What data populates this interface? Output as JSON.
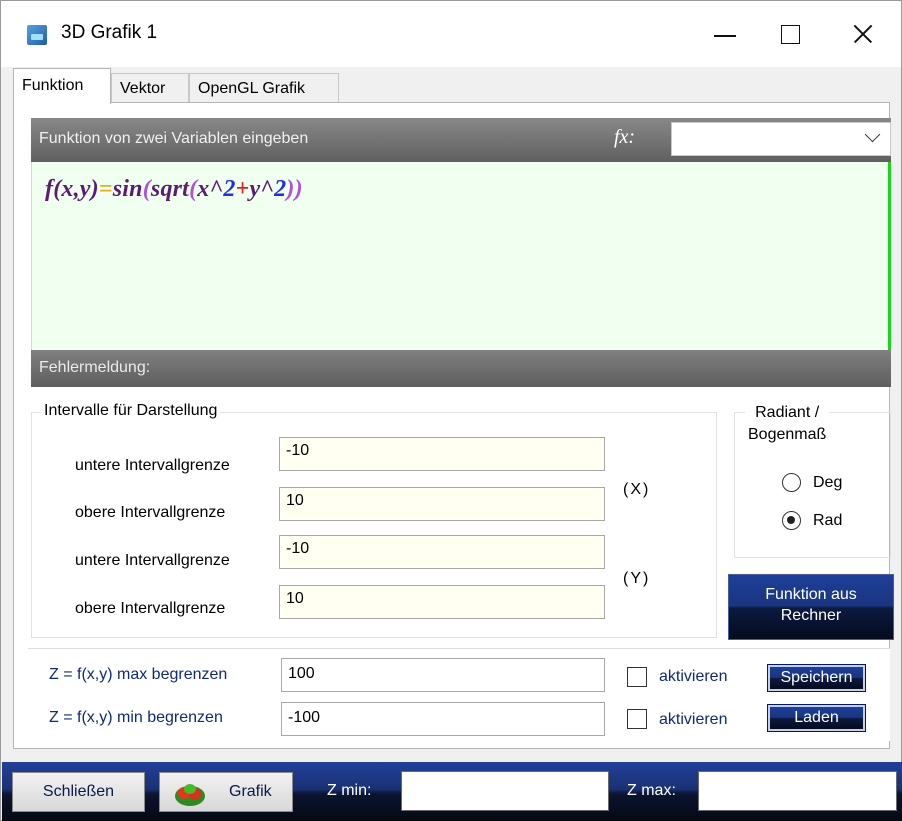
{
  "window": {
    "title": "3D Grafik 1",
    "icon": "app-3d-icon",
    "controls": [
      "minimize-icon",
      "maximize-icon",
      "close-icon"
    ]
  },
  "tabs": [
    {
      "label": "Funktion",
      "active": true
    },
    {
      "label": "Vektor",
      "active": false
    },
    {
      "label": "OpenGL Grafik",
      "active": false
    }
  ],
  "function_bar": {
    "label": "Funktion von zwei Variablen eingeben",
    "fx_label": "fx:",
    "fx_selected": ""
  },
  "formula": {
    "lhs": "f(x,y)",
    "eq": "=",
    "fn": "sin",
    "open1": "(",
    "inner_fn": "sqrt",
    "open2": "(",
    "x": "x^",
    "two1": "2",
    "plus": "+",
    "y": "y^",
    "two2": "2",
    "close": "))"
  },
  "error_bar": {
    "label": "Fehlermeldung:"
  },
  "intervals": {
    "legend": "Intervalle für Darstellung",
    "rows": [
      {
        "label": "untere Intervallgrenze",
        "value": "-10"
      },
      {
        "label": "obere Intervallgrenze",
        "value": "10"
      },
      {
        "label": "untere Intervallgrenze",
        "value": "-10"
      },
      {
        "label": "obere Intervallgrenze",
        "value": "10"
      }
    ],
    "axis_x": "(X)",
    "axis_y": "(Y)"
  },
  "angle_mode": {
    "legend_line1": "Radiant /",
    "legend_line2": "Bogenmaß",
    "options": [
      {
        "label": "Deg",
        "checked": false
      },
      {
        "label": "Rad",
        "checked": true
      }
    ]
  },
  "calc_button": {
    "line1": "Funktion aus",
    "line2": "Rechner"
  },
  "limits": {
    "max": {
      "label": "Z = f(x,y) max begrenzen",
      "value": "100",
      "check_label": "aktivieren",
      "checked": false
    },
    "min": {
      "label": "Z = f(x,y) min begrenzen",
      "value": "-100",
      "check_label": "aktivieren",
      "checked": false
    },
    "save_label": "Speichern",
    "load_label": "Laden"
  },
  "bottom": {
    "close_label": "Schließen",
    "graph_label": "Grafik",
    "zmin_label": "Z min:",
    "zmin_value": "",
    "zmax_label": "Z max:",
    "zmax_value": ""
  },
  "colors": {
    "header_gray": "#707070",
    "formula_bg": "#f1fff1",
    "input_bg": "#fffff2",
    "dark_button": "#1a3173",
    "accent_green": "#22d022"
  }
}
